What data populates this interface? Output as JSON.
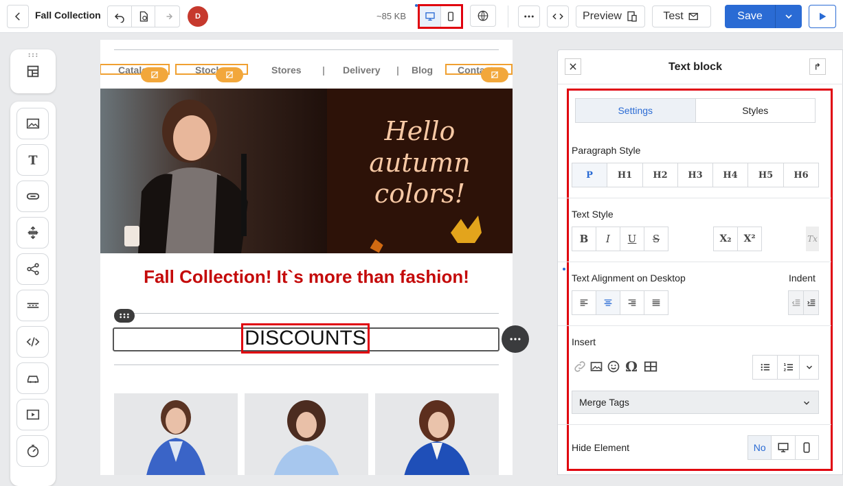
{
  "header": {
    "title": "Fall Collection",
    "avatar_initial": "D",
    "file_size": "~85 KB",
    "preview_label": "Preview",
    "test_label": "Test",
    "save_label": "Save"
  },
  "canvas": {
    "menu": [
      "Catalog",
      "Stock",
      "Stores",
      "Delivery",
      "Blog",
      "Contact"
    ],
    "hero_text_lines": [
      "Hello",
      "autumn",
      "colors!"
    ],
    "headline": "Fall Collection! It`s more than fashion!",
    "selected_text": "DISCOUNTS"
  },
  "panel": {
    "title": "Text block",
    "tabs": [
      "Settings",
      "Styles"
    ],
    "paragraph_style_label": "Paragraph Style",
    "paragraph_styles": [
      "P",
      "H1",
      "H2",
      "H3",
      "H4",
      "H5",
      "H6"
    ],
    "text_style_label": "Text Style",
    "text_alignment_label": "Text Alignment on Desktop",
    "indent_label": "Indent",
    "insert_label": "Insert",
    "merge_tags_label": "Merge Tags",
    "hide_element_label": "Hide Element",
    "hide_no_label": "No"
  },
  "colors": {
    "accent": "#2a6bd4",
    "highlight_red": "#e0000d",
    "headline_red": "#c40a0a",
    "badge_orange": "#f2a73b"
  }
}
